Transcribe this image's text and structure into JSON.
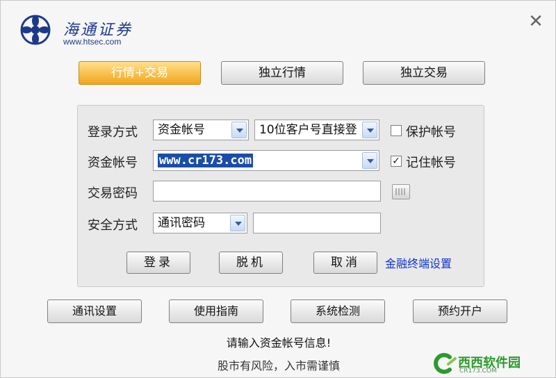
{
  "logo": {
    "name": "海通证券",
    "url": "www.htsec.com"
  },
  "close_label": "✕",
  "modes": [
    "行情+交易",
    "独立行情",
    "独立交易"
  ],
  "login": {
    "method_label": "登录方式",
    "method_value": "资金帐号",
    "method2_value": "10位客户号直接登",
    "protect_label": "保护帐号",
    "account_label": "资金帐号",
    "account_value": "www.cr173.com",
    "remember_label": "记住帐号",
    "remember_check": "✓",
    "password_label": "交易密码",
    "password_value": "",
    "security_label": "安全方式",
    "security_value": "通讯密码",
    "security_input_value": ""
  },
  "actions": {
    "login": "登录",
    "offline": "脱机",
    "cancel": "取消",
    "link": "金融终端设置"
  },
  "bottom": [
    "通讯设置",
    "使用指南",
    "系统检测",
    "预约开户"
  ],
  "status_text": "请输入资金帐号信息!",
  "risk_text": "股市有风险，入市需谨慎",
  "watermark": {
    "name": "西西软件园",
    "sub": "CR173.COM"
  },
  "colors": {
    "accent": "#f2a51c",
    "selection": "#1a4da8",
    "link": "#1133cc",
    "brand": "#1d3a8a"
  }
}
